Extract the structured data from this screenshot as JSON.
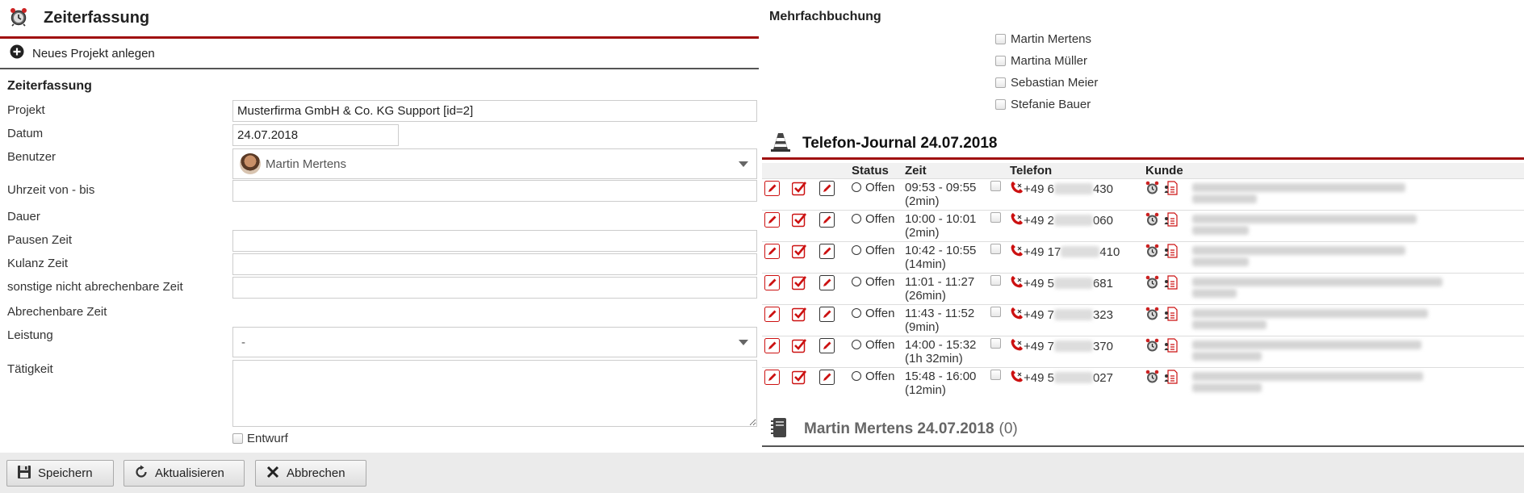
{
  "header": {
    "title": "Zeiterfassung",
    "icon": "alarm-clock-icon"
  },
  "toolbar": {
    "new_project": "Neues Projekt anlegen"
  },
  "form": {
    "section_title": "Zeiterfassung",
    "projekt_label": "Projekt",
    "projekt_value": "Musterfirma GmbH & Co. KG Support [id=2]",
    "datum_label": "Datum",
    "datum_value": "24.07.2018",
    "benutzer_label": "Benutzer",
    "benutzer_value": "Martin Mertens",
    "uhrzeit_label": "Uhrzeit von - bis",
    "uhrzeit_value": "",
    "dauer_label": "Dauer",
    "pausen_label": "Pausen Zeit",
    "pausen_value": "",
    "kulanz_label": "Kulanz Zeit",
    "kulanz_value": "",
    "sonstige_label": "sonstige nicht abrechenbare Zeit",
    "sonstige_value": "",
    "abrechenbar_label": "Abrechenbare Zeit",
    "leistung_label": "Leistung",
    "leistung_value": "-",
    "taetigkeit_label": "Tätigkeit",
    "taetigkeit_value": "",
    "entwurf_label": "Entwurf"
  },
  "buttons": {
    "save": "Speichern",
    "refresh": "Aktualisieren",
    "cancel": "Abbrechen"
  },
  "mehrfach": {
    "title": "Mehrfachbuchung",
    "users": [
      "Martin Mertens",
      "Martina Müller",
      "Sebastian Meier",
      "Stefanie Bauer"
    ]
  },
  "journal": {
    "title": "Telefon-Journal 24.07.2018",
    "columns": {
      "status": "Status",
      "zeit": "Zeit",
      "telefon": "Telefon",
      "kunde": "Kunde"
    },
    "rows": [
      {
        "status": "Offen",
        "zeit": "09:53 - 09:55",
        "dauer": "(2min)",
        "tel_start": "+49 6",
        "tel_end": "430"
      },
      {
        "status": "Offen",
        "zeit": "10:00 - 10:01",
        "dauer": "(2min)",
        "tel_start": "+49 2",
        "tel_end": "060"
      },
      {
        "status": "Offen",
        "zeit": "10:42 - 10:55",
        "dauer": "(14min)",
        "tel_start": "+49 17",
        "tel_end": "410"
      },
      {
        "status": "Offen",
        "zeit": "11:01 - 11:27",
        "dauer": "(26min)",
        "tel_start": "+49 5",
        "tel_end": "681"
      },
      {
        "status": "Offen",
        "zeit": "11:43 - 11:52",
        "dauer": "(9min)",
        "tel_start": "+49 7",
        "tel_end": "323"
      },
      {
        "status": "Offen",
        "zeit": "14:00 - 15:32",
        "dauer": "(1h 32min)",
        "tel_start": "+49 7",
        "tel_end": "370"
      },
      {
        "status": "Offen",
        "zeit": "15:48 - 16:00",
        "dauer": "(12min)",
        "tel_start": "+49 5",
        "tel_end": "027"
      }
    ]
  },
  "summary": {
    "title": "Martin Mertens 24.07.2018",
    "count": "(0)"
  },
  "colors": {
    "accent": "#a01010",
    "edit_red": "#cc1111"
  }
}
